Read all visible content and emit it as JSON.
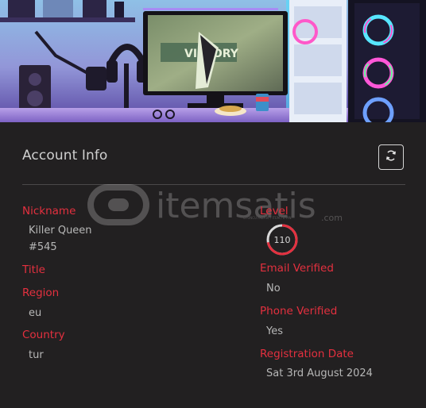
{
  "banner": {
    "monitor_text": "VICTORY"
  },
  "card": {
    "title": "Account Info",
    "refresh_icon": "refresh-icon"
  },
  "watermark": {
    "brand": "itemsatis",
    "suffix": ".com",
    "tagline": "OYUNCU PAZARI / ITEM / E-PIN"
  },
  "left_fields": {
    "nickname_label": "Nickname",
    "nickname_line1": "Killer Queen",
    "nickname_line2": "#545",
    "title_label": "Title",
    "region_label": "Region",
    "region_value": "eu",
    "country_label": "Country",
    "country_value": "tur"
  },
  "right_fields": {
    "level_label": "Level",
    "level_value": "110",
    "level_progress": 0.72,
    "email_label": "Email Verified",
    "email_value": "No",
    "phone_label": "Phone Verified",
    "phone_value": "Yes",
    "registration_label": "Registration Date",
    "registration_value": "Sat 3rd August 2024"
  },
  "colors": {
    "background": "#222021",
    "label": "#e4303f",
    "value": "#b7b7b7",
    "title": "#cfcfcf",
    "ring_track": "#d9d9d9",
    "ring_progress": "#e4303f"
  }
}
